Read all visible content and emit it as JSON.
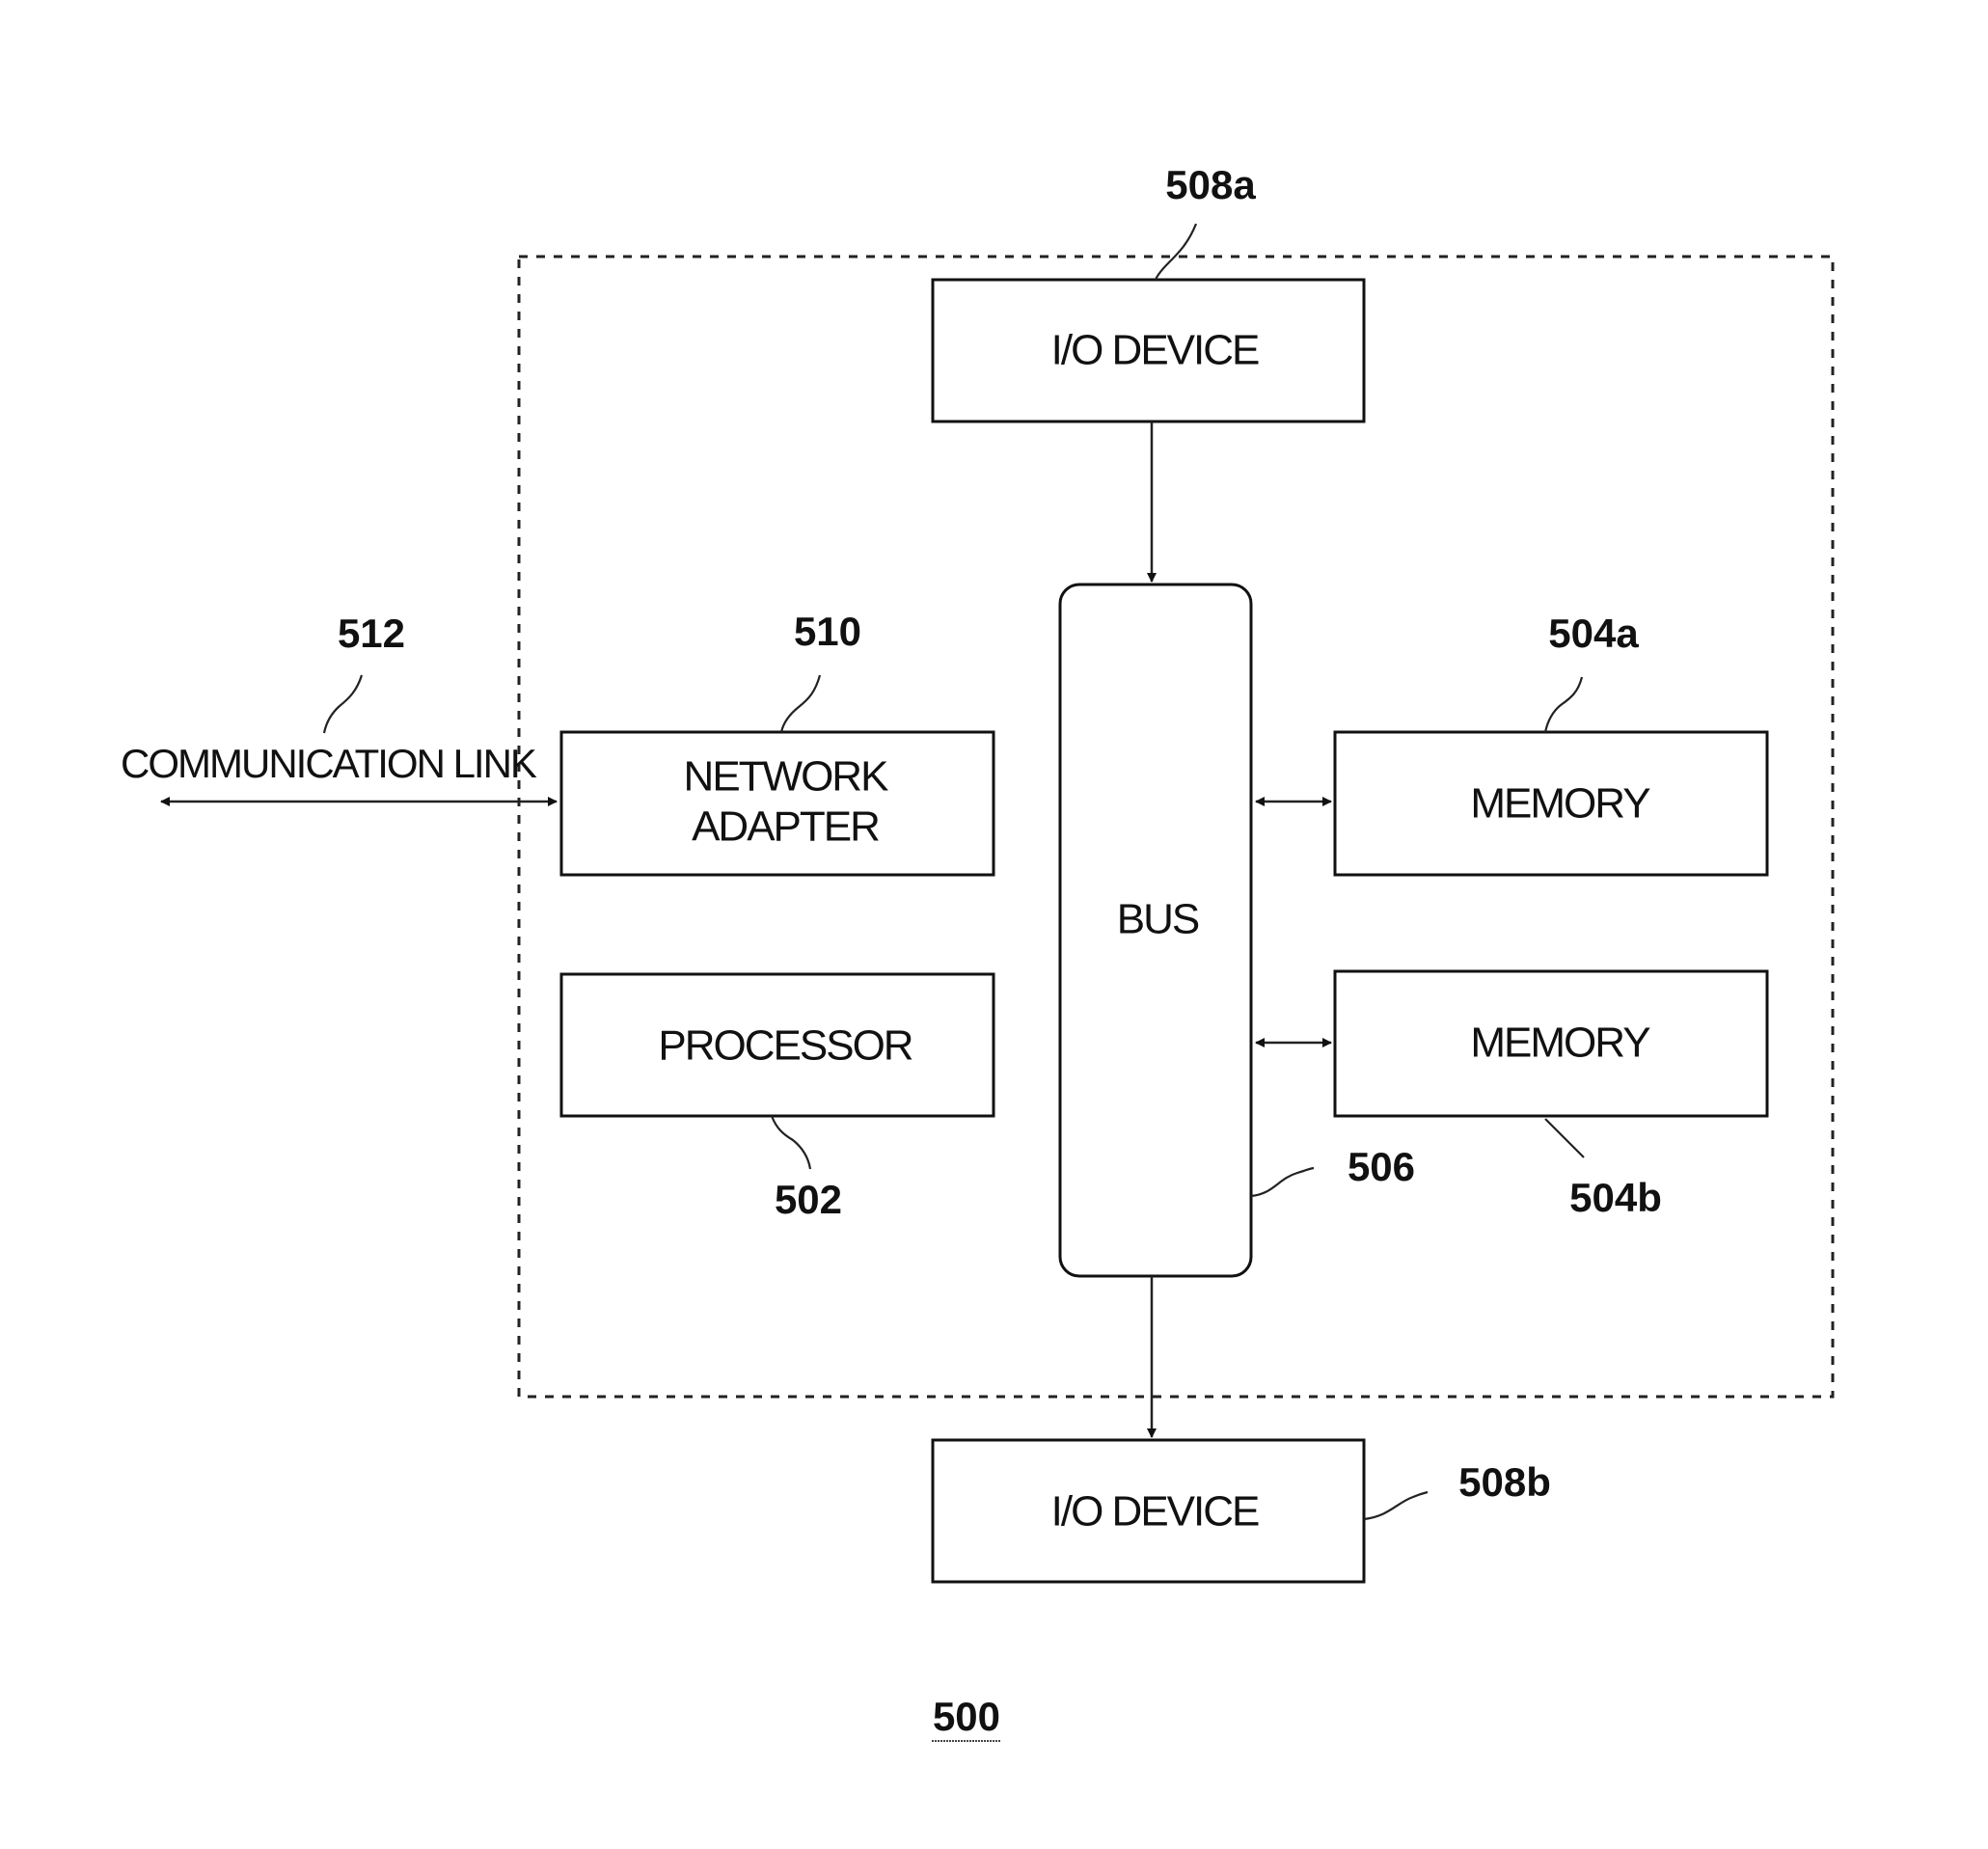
{
  "figure": {
    "number": "500",
    "system_boundary": "dashed"
  },
  "components": {
    "io_device_top": {
      "label": "I/O DEVICE",
      "ref": "508a"
    },
    "bus": {
      "label": "BUS",
      "ref": "506"
    },
    "network_adapter": {
      "label_line1": "NETWORK",
      "label_line2": "ADAPTER",
      "ref": "510"
    },
    "processor": {
      "label": "PROCESSOR",
      "ref": "502"
    },
    "memory_a": {
      "label": "MEMORY",
      "ref": "504a"
    },
    "memory_b": {
      "label": "MEMORY",
      "ref": "504b"
    },
    "io_device_bottom": {
      "label": "I/O DEVICE",
      "ref": "508b"
    },
    "communication_link": {
      "label": "COMMUNICATION LINK",
      "ref": "512"
    }
  },
  "connections": [
    {
      "from": "I/O DEVICE (508a)",
      "to": "BUS",
      "type": "one-way"
    },
    {
      "from": "BUS",
      "to": "I/O DEVICE (508b)",
      "type": "one-way"
    },
    {
      "from": "BUS",
      "to": "MEMORY (504a)",
      "type": "two-way"
    },
    {
      "from": "BUS",
      "to": "MEMORY (504b)",
      "type": "two-way"
    },
    {
      "from": "COMMUNICATION LINK",
      "to": "NETWORK ADAPTER",
      "type": "two-way"
    }
  ],
  "colors": {
    "ink": "#111111",
    "background": "#ffffff"
  }
}
